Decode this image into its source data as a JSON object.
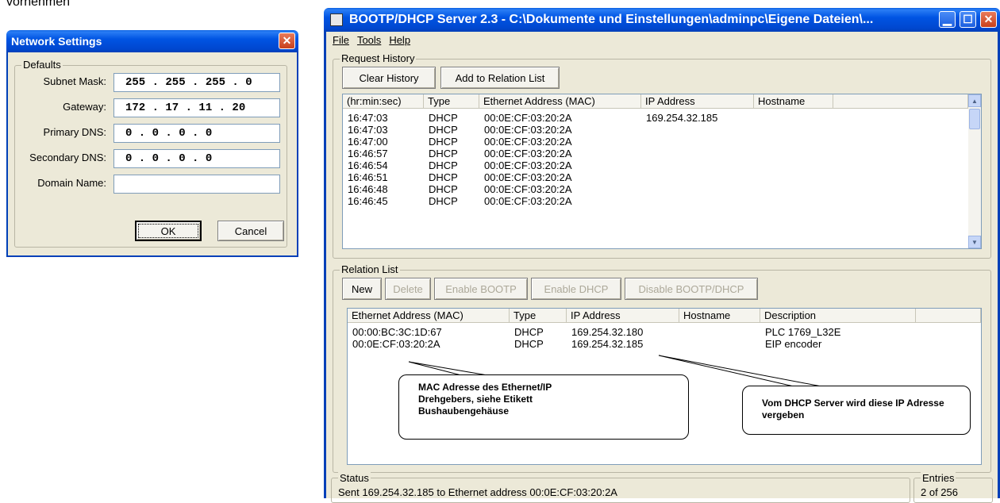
{
  "background_text": "vornehmen",
  "network_dialog": {
    "title": "Network Settings",
    "group_label": "Defaults",
    "fields": [
      {
        "label": "Subnet Mask:",
        "value": "255 . 255 . 255 .  0"
      },
      {
        "label": "Gateway:",
        "value": "172 . 17  . 11  . 20"
      },
      {
        "label": "Primary DNS:",
        "value": " 0  .  0  .  0  .  0"
      },
      {
        "label": "Secondary DNS:",
        "value": " 0  .  0  .  0  .  0"
      },
      {
        "label": "Domain Name:",
        "value": ""
      }
    ],
    "ok_label": "OK",
    "cancel_label": "Cancel"
  },
  "server_window": {
    "title": "BOOTP/DHCP Server 2.3 - C:\\Dokumente und Einstellungen\\adminpc\\Eigene Dateien\\...",
    "menu": [
      "File",
      "Tools",
      "Help"
    ],
    "request_history": {
      "label": "Request History",
      "buttons": [
        "Clear History",
        "Add to Relation List"
      ],
      "columns": [
        "(hr:min:sec)",
        "Type",
        "Ethernet Address (MAC)",
        "IP Address",
        "Hostname"
      ],
      "rows": [
        [
          "16:47:03",
          "DHCP",
          "00:0E:CF:03:20:2A",
          "169.254.32.185",
          ""
        ],
        [
          "16:47:03",
          "DHCP",
          "00:0E:CF:03:20:2A",
          "",
          ""
        ],
        [
          "16:47:00",
          "DHCP",
          "00:0E:CF:03:20:2A",
          "",
          ""
        ],
        [
          "16:46:57",
          "DHCP",
          "00:0E:CF:03:20:2A",
          "",
          ""
        ],
        [
          "16:46:54",
          "DHCP",
          "00:0E:CF:03:20:2A",
          "",
          ""
        ],
        [
          "16:46:51",
          "DHCP",
          "00:0E:CF:03:20:2A",
          "",
          ""
        ],
        [
          "16:46:48",
          "DHCP",
          "00:0E:CF:03:20:2A",
          "",
          ""
        ],
        [
          "16:46:45",
          "DHCP",
          "00:0E:CF:03:20:2A",
          "",
          ""
        ]
      ]
    },
    "relation_list": {
      "label": "Relation List",
      "buttons": [
        "New",
        "Delete",
        "Enable BOOTP",
        "Enable DHCP",
        "Disable BOOTP/DHCP"
      ],
      "columns": [
        "Ethernet Address (MAC)",
        "Type",
        "IP Address",
        "Hostname",
        "Description"
      ],
      "rows": [
        [
          "00:00:BC:3C:1D:67",
          "DHCP",
          "169.254.32.180",
          "",
          "PLC 1769_L32E"
        ],
        [
          "00:0E:CF:03:20:2A",
          "DHCP",
          "169.254.32.185",
          "",
          "EIP encoder"
        ]
      ]
    },
    "status": {
      "label": "Status",
      "text": "Sent 169.254.32.185 to Ethernet address 00:0E:CF:03:20:2A"
    },
    "entries": {
      "label": "Entries",
      "text": "2 of 256"
    }
  },
  "callouts": {
    "mac": "MAC Adresse des Ethernet/IP Drehgebers, siehe Etikett Bushaubengehäuse",
    "ip": "Vom DHCP Server wird diese IP Adresse vergeben"
  }
}
